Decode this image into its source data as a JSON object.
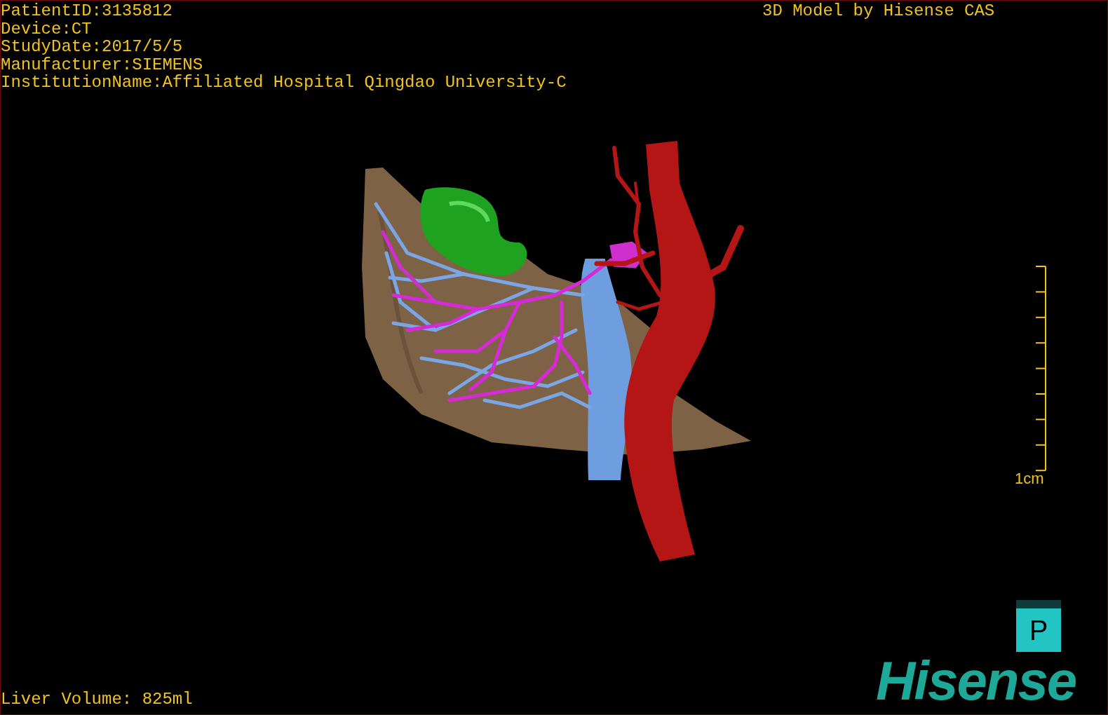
{
  "patient_info": [
    "PatientID:3135812",
    "Device:CT",
    "StudyDate:2017/5/5",
    "Manufacturer:SIEMENS",
    "InstitutionName:Affiliated Hospital Qingdao University-C"
  ],
  "viewer_title": "3D Model by Hisense CAS",
  "scale_bar": {
    "label": "1cm"
  },
  "orientation_marker": {
    "label": "P"
  },
  "liver_volume": "Liver Volume: 825ml",
  "logo": "Hisense"
}
